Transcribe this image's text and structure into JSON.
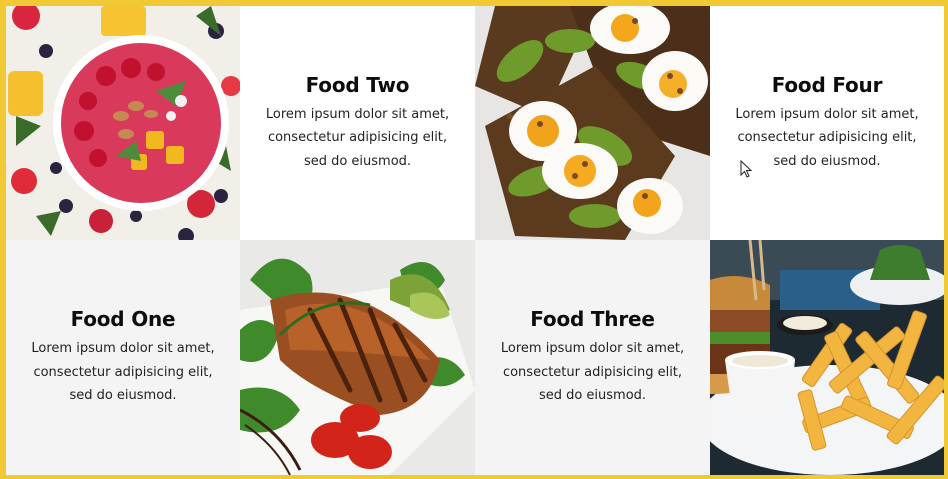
{
  "cards": [
    {
      "title": "Food Two",
      "description": "Lorem ipsum dolor sit amet, consectetur adipisicing elit, sed do eiusmod."
    },
    {
      "title": "Food Four",
      "description": "Lorem ipsum dolor sit amet, consectetur adipisicing elit, sed do eiusmod."
    },
    {
      "title": "Food One",
      "description": "Lorem ipsum dolor sit amet, consectetur adipisicing elit, sed do eiusmod."
    },
    {
      "title": "Food Three",
      "description": "Lorem ipsum dolor sit amet, consectetur adipisicing elit, sed do eiusmod."
    }
  ],
  "colors": {
    "frame": "#f1c934",
    "card_bg": "#ffffff",
    "card_bg_alt": "#f4f4f4",
    "title": "#0d0d0d"
  }
}
